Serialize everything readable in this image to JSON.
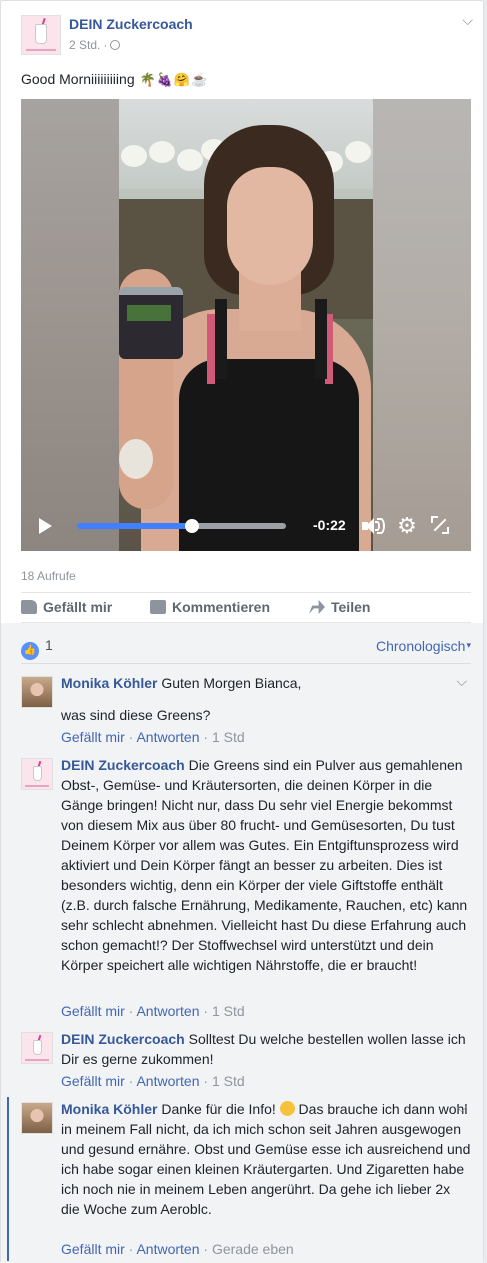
{
  "post": {
    "author": "DEIN Zuckercoach",
    "time": "2 Std.",
    "text": "Good Morniiiiiiiiing",
    "emojis": [
      "palm-tree-emoji",
      "grapes-emoji",
      "hugging-emoji",
      "coffee-emoji"
    ]
  },
  "video": {
    "time_remaining": "-0:22",
    "progress": 0.55
  },
  "views": "18 Aufrufe",
  "actions": {
    "like": "Gefällt mir",
    "comment": "Kommentieren",
    "share": "Teilen"
  },
  "reactions": {
    "count": "1",
    "sort": "Chronologisch"
  },
  "comments": [
    {
      "author": "Monika Köhler",
      "text_line1": "Guten Morgen Bianca,",
      "text_line2": "was sind diese Greens?",
      "like": "Gefällt mir",
      "reply": "Antworten",
      "time": "1 Std"
    },
    {
      "author": "DEIN Zuckercoach",
      "text": "Die Greens sind ein Pulver aus gemahlenen Obst-, Gemüse- und Kräutersorten, die deinen Körper in die Gänge bringen! Nicht nur, dass Du sehr viel Energie bekommst von diesem Mix aus über 80 frucht- und Gemüsesorten, Du tust Deinem Körper vor allem was Gutes. Ein Entgiftunsprozess wird aktiviert und Dein Körper fängt an besser zu arbeiten. Dies ist besonders wichtig, denn ein Körper der viele Giftstoffe enthält (z.B. durch falsche Ernährung, Medikamente, Rauchen, etc) kann sehr schlecht abnehmen. Vielleicht hast Du diese Erfahrung auch schon gemacht!? Der Stoffwechsel wird unterstützt und dein Körper speichert alle wichtigen Nährstoffe, die er braucht!",
      "like": "Gefällt mir",
      "reply": "Antworten",
      "time": "1 Std"
    },
    {
      "author": "DEIN Zuckercoach",
      "text": "Solltest Du welche bestellen wollen lasse ich Dir es gerne zukommen!",
      "like": "Gefällt mir",
      "reply": "Antworten",
      "time": "1 Std"
    },
    {
      "author": "Monika Köhler",
      "text_a": "Danke für die Info!",
      "text_b": "Das brauche ich dann wohl in meinem Fall nicht, da ich mich schon seit Jahren ausgewogen und gesund ernähre. Obst und Gemüse esse ich ausreichend und ich habe sogar einen kleinen Kräutergarten. Und Zigaretten habe ich noch nie in meinem Leben angerührt. Da gehe ich lieber 2x die Woche zum Aeroblc.",
      "like": "Gefällt mir",
      "reply": "Antworten",
      "time": "Gerade eben"
    }
  ],
  "colors": {
    "link": "#365899",
    "accent": "#4267b2",
    "progress": "#4080ff",
    "muted": "#90949c"
  }
}
